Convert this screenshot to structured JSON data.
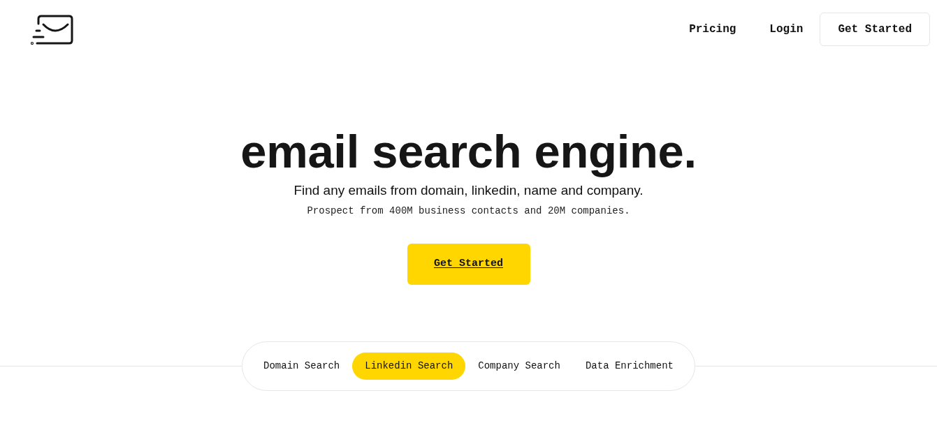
{
  "header": {
    "nav_links": [
      {
        "label": "Pricing"
      },
      {
        "label": "Login"
      }
    ],
    "cta": "Get Started"
  },
  "hero": {
    "title": "email search engine.",
    "subtitle": "Find any emails from domain, linkedin, name and company.",
    "tagline": "Prospect from 400M business contacts and 20M companies.",
    "cta": "Get Started"
  },
  "search_tabs": [
    {
      "label": "Domain Search",
      "selected": false
    },
    {
      "label": "Linkedin Search",
      "selected": true
    },
    {
      "label": "Company Search",
      "selected": false
    },
    {
      "label": "Data Enrichment",
      "selected": false
    }
  ]
}
